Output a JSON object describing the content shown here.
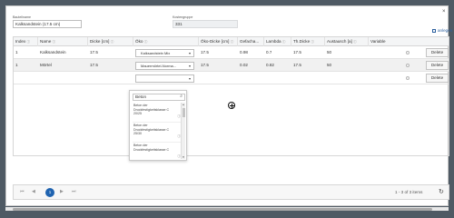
{
  "form": {
    "bauteilname_label": "Bauteilname",
    "bauteilname_value": "Kalksandstein (17.5 cm)",
    "kostengruppe_label": "Kostengruppe",
    "kostengruppe_value": "331",
    "add_label": "anlegen",
    "close_glyph": "×"
  },
  "grid": {
    "columns": [
      {
        "label": "Index",
        "info": "ⓘ"
      },
      {
        "label": "Name",
        "info": "ⓘ"
      },
      {
        "label": "Dicke [cm]",
        "info": "ⓘ"
      },
      {
        "label": "Öko",
        "info": "ⓘ"
      },
      {
        "label": "Öko-Dicke [cm]",
        "info": "ⓘ"
      },
      {
        "label": "Gefacha...",
        "info": ""
      },
      {
        "label": "Lambda",
        "info": "ⓘ"
      },
      {
        "label": "Th.Dicke",
        "info": "ⓘ"
      },
      {
        "label": "Austausch [a]",
        "info": "ⓘ"
      },
      {
        "label": "Variable",
        "info": ""
      }
    ],
    "rows": [
      {
        "index": "1",
        "name": "Kalksandstein",
        "dicke": "17.5",
        "oeko": "Kalksandstein Mix",
        "oeko_dicke": "17.5",
        "gefach": "0.98",
        "lambda": "0.7",
        "th_dicke": "17.5",
        "austausch": "50",
        "delete": "Delete"
      },
      {
        "index": "1",
        "name": "Mörtel",
        "dicke": "17.5",
        "oeko": "Mauermörtel-Norma...",
        "oeko_dicke": "17.5",
        "gefach": "0.02",
        "lambda": "0.82",
        "th_dicke": "17.5",
        "austausch": "50",
        "delete": "Delete"
      },
      {
        "index": "",
        "name": "",
        "dicke": "",
        "oeko": "",
        "oeko_dicke": "",
        "gefach": "",
        "lambda": "",
        "th_dicke": "",
        "austausch": "",
        "delete": "Delete"
      }
    ],
    "caret_glyph": "▾"
  },
  "dropdown": {
    "search_value": "Beton",
    "search_icon": "search-icon",
    "items": [
      {
        "line1": "Beton der",
        "line2": "Druckfestigkeitsklasse C",
        "line3": "20/25"
      },
      {
        "line1": "Beton der",
        "line2": "Druckfestigkeitsklasse C",
        "line3": "25/30"
      },
      {
        "line1": "Beton der",
        "line2": "Druckfestigkeitsklasse C",
        "line3": ""
      }
    ],
    "info_glyph": "ⓘ"
  },
  "pager": {
    "first": "⏮",
    "prev": "◀",
    "current_page": "1",
    "next": "▶",
    "last": "⏭",
    "status": "1 - 3 of 3 items",
    "refresh_glyph": "↻"
  },
  "colors": {
    "accent": "#1f63b0",
    "link": "#2b5f9e"
  }
}
